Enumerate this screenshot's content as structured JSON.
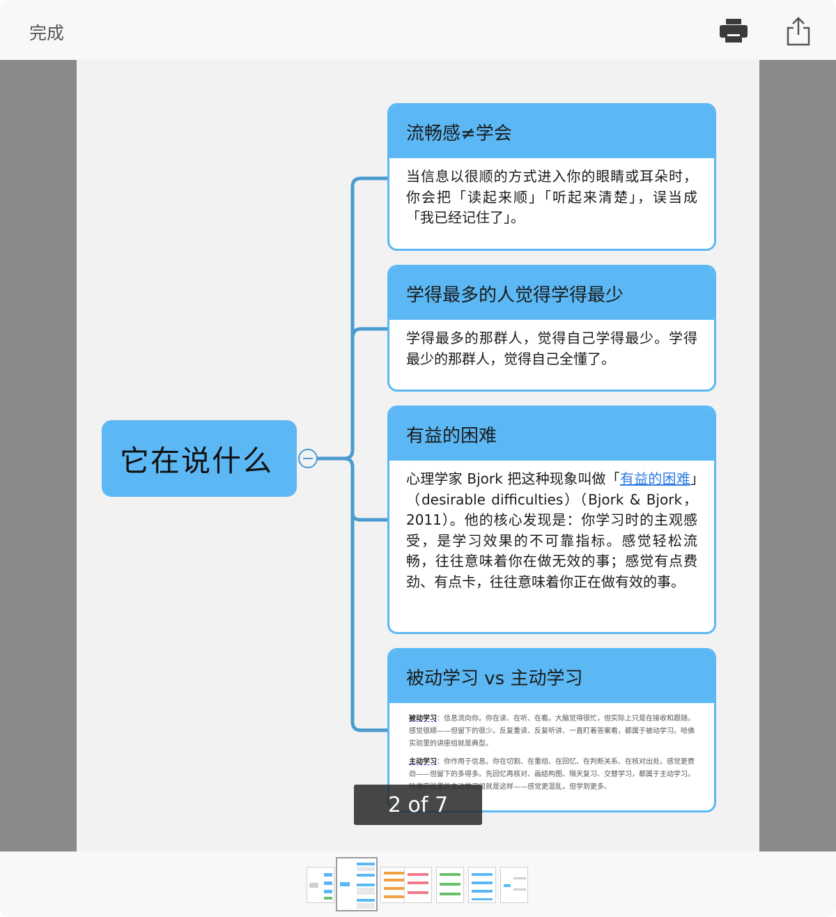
{
  "toolbar": {
    "done_label": "完成",
    "print_icon": "printer-icon",
    "share_icon": "share-icon"
  },
  "mindmap": {
    "root": {
      "title": "它在说什么"
    },
    "cards": [
      {
        "title": "流畅感≠学会",
        "body": "当信息以很顺的方式进入你的眼睛或耳朵时，你会把「读起来顺」「听起来清楚」，误当成「我已经记住了」。"
      },
      {
        "title": "学得最多的人觉得学得最少",
        "body": "学得最多的那群人，觉得自己学得最少。学得最少的那群人，觉得自己全懂了。"
      },
      {
        "title": "有益的困难",
        "body_before": "心理学家 Bjork 把这种现象叫做「",
        "link": "有益的困难",
        "body_after": "」（desirable difficulties）（Bjork & Bjork，2011）。他的核心发现是：你学习时的主观感受，是学习效果的不可靠指标。感觉轻松流畅，往往意味着你在做无效的事；感觉有点费劲、有点卡，往往意味着你正在做有效的事。"
      },
      {
        "title": "被动学习 vs 主动学习",
        "passive_term": "被动学习",
        "passive_text": "：信息流向你。你在读、在听、在看。大脑觉得很忙，但实际上只是在接收和跟随。感觉很顺——但留下的很少。反复重读、反复听讲、一直盯着答案看，都属于被动学习。哈佛实验里的讲座组就是典型。",
        "active_term": "主动学习",
        "active_text": "：你作用于信息。你在切割、在重组、在回忆、在判断关系、在核对出处。感觉更费劲——但留下的多得多。先回忆再核对、画结构图、隔天复习、交替学习，都属于主动学习。哈佛实验里的主动学习组就是这样——感觉更混乱，但学到更多。"
      }
    ]
  },
  "pager": {
    "label": "2 of 7",
    "current": 2,
    "total": 7
  },
  "colors": {
    "node_blue": "#5bb8f5",
    "connector_blue": "#4a9bd0",
    "link_blue": "#2f7be0"
  }
}
